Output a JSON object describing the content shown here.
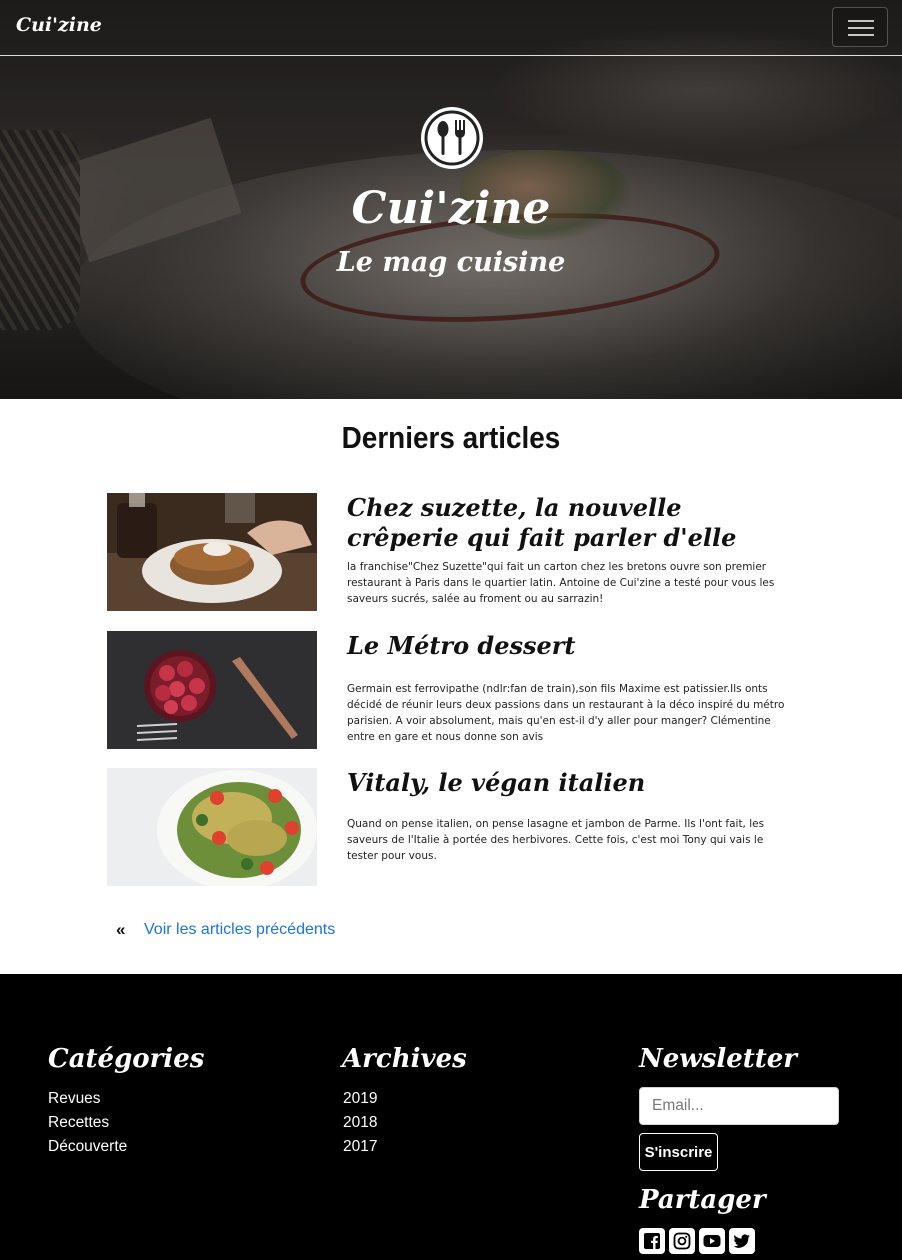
{
  "navbar": {
    "brand": "Cui'zine",
    "toggle_icon": "hamburger-icon"
  },
  "hero": {
    "icon": "cutlery-icon",
    "title": "Cui'zine",
    "subtitle": "Le mag cuisine"
  },
  "articles_section": {
    "title": "Derniers articles",
    "items": [
      {
        "title": "Chez suzette, la nouvelle crêperie qui fait parler d'elle",
        "text": "la franchise\"Chez Suzette\"qui fait un carton chez les bretons ouvre son premier restaurant à Paris dans le quartier latin. Antoine de Cui'zine a testé pour vous les saveurs sucrés, salée au froment ou au sarrazin!"
      },
      {
        "title": "Le Métro dessert",
        "text": "Germain est ferrovipathe (ndlr:fan de train),son fils Maxime est patissier.Ils onts décidé de réunir leurs deux passions dans un restaurant à la déco inspiré du métro parisien. A voir absolument, mais qu'en est-il d'y aller pour manger? Clémentine entre en gare et nous donne son avis"
      },
      {
        "title": "Vitaly, le végan italien",
        "text": "Quand on pense italien, on pense lasagne et jambon de Parme. Ils l'ont fait, les saveurs de l'Italie à portée des herbivores. Cette fois, c'est moi Tony qui vais le tester pour vous."
      }
    ],
    "previous_chevron": "«",
    "previous_link": "Voir les articles précédents"
  },
  "footer": {
    "categories": {
      "title": "Catégories",
      "items": [
        "Revues",
        "Recettes",
        "Découverte"
      ]
    },
    "archives": {
      "title": "Archives",
      "items": [
        "2019",
        "2018",
        "2017"
      ]
    },
    "newsletter": {
      "title": "Newsletter",
      "email_placeholder": "Email...",
      "email_value": "",
      "subscribe_label": "S'inscrire"
    },
    "share": {
      "title": "Partager",
      "icons": [
        "facebook-icon",
        "instagram-icon",
        "youtube-icon",
        "twitter-icon"
      ]
    }
  },
  "colors": {
    "link": "#1a73e8",
    "footer_bg": "#000000",
    "text": "#111111"
  }
}
